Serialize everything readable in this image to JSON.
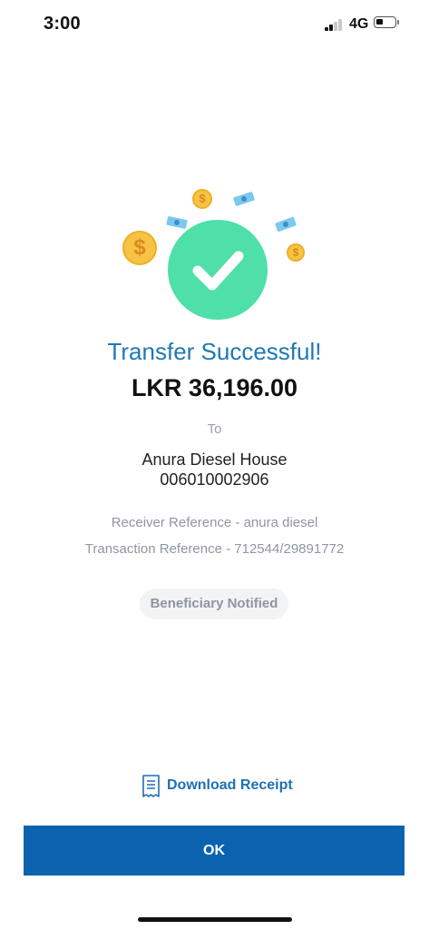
{
  "status_bar": {
    "time": "3:00",
    "network": "4G",
    "signal_bars_active": 2,
    "signal_bars_total": 4,
    "battery_level": 0.3
  },
  "result": {
    "title": "Transfer Successful!",
    "amount": "LKR 36,196.00",
    "to_label": "To",
    "payee_name": "Anura Diesel House",
    "payee_account": "006010002906",
    "receiver_reference": "Receiver Reference - anura diesel",
    "transaction_reference": "Transaction Reference - 712544/29891772",
    "notification_badge": "Beneficiary Notified"
  },
  "illustration": {
    "icons": [
      "check-icon",
      "dollar-coin-icon",
      "banknote-icon"
    ],
    "coin_symbol": "$"
  },
  "actions": {
    "download_receipt_label": "Download Receipt",
    "ok_label": "OK"
  },
  "colors": {
    "accent_blue": "#1f78b4",
    "button_blue": "#0b63b0",
    "success_green": "#4ee0a8",
    "coin_gold": "#f6c344",
    "bill_blue": "#7cc8f2",
    "muted_text": "#8f96a3"
  }
}
